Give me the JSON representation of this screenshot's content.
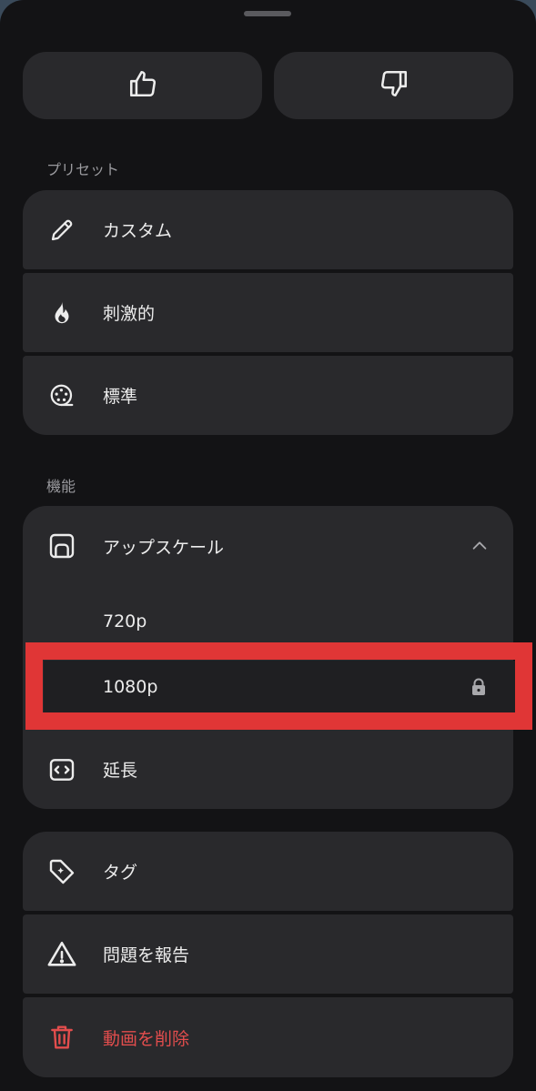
{
  "colors": {
    "sheet_bg": "#131315",
    "card_bg": "#29292c",
    "text": "#ececec",
    "muted": "#9a9a9e",
    "danger": "#e24d4d",
    "highlight_box": "#e03636"
  },
  "feedback": {
    "like_icon": "thumbs-up-icon",
    "dislike_icon": "thumbs-down-icon"
  },
  "presets": {
    "section_label": "プリセット",
    "items": [
      {
        "label": "カスタム",
        "icon": "pencil-icon"
      },
      {
        "label": "刺激的",
        "icon": "flame-icon"
      },
      {
        "label": "標準",
        "icon": "film-reel-icon"
      }
    ]
  },
  "features": {
    "section_label": "機能",
    "upscale": {
      "label": "アップスケール",
      "icon": "upscale-icon",
      "expanded": true,
      "options": [
        {
          "label": "720p",
          "locked": false
        },
        {
          "label": "1080p",
          "locked": true
        }
      ]
    },
    "extend": {
      "label": "延長",
      "icon": "extend-icon"
    }
  },
  "actions": [
    {
      "label": "タグ",
      "icon": "tag-icon"
    },
    {
      "label": "問題を報告",
      "icon": "warning-icon"
    },
    {
      "label": "動画を削除",
      "icon": "trash-icon",
      "danger": true
    }
  ]
}
